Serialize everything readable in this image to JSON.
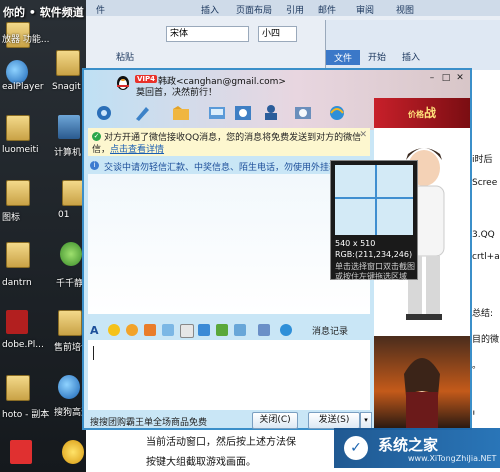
{
  "watermark_top": "你的 • 软件频道 software.it168.com",
  "word": {
    "tabs": [
      "件",
      "插入",
      "页面布局",
      "引用",
      "邮件",
      "审阅",
      "视图"
    ],
    "font": "宋体",
    "size": "小四",
    "paste": "粘贴",
    "tabs2": [
      "文件",
      "开始",
      "插入"
    ]
  },
  "desktop_icons": [
    "放器 功能...",
    "ealPlayer",
    "Snagit",
    "luomeiti",
    "计算机",
    "图标",
    "01",
    "dantrn",
    "千千静听",
    "dobe.Pl...",
    "售前培训-务器建设",
    "hoto - 副本",
    "搜狗高速浏览器"
  ],
  "doc_right": [
    "i时后",
    "Scree",
    "3.QQ",
    "crtl+a",
    "总结:",
    "目的微",
    "。",
    "!"
  ],
  "doc_bottom": [
    "当前活动窗口，然后按上述方法保",
    "按键大组截取游戏画面。"
  ],
  "qq": {
    "vip": "VIP4",
    "name": "韩政<canghan@gmail.com>",
    "signature": "莫回首，决然前行！",
    "toolbar_icons": [
      "video-call",
      "voice-call",
      "send-file",
      "create-discussion",
      "group-chat",
      "remote-assist",
      "apps",
      "ie"
    ],
    "notice_line1": "对方开通了微信接收QQ消息，您的消息将免费发送到对方的微信",
    "notice_line2_prefix": "信，",
    "notice_link": "点击查看详情",
    "warn": "交谈中请勿轻信汇款、中奖信息、陌生电话，勿使用外挂软件",
    "history": "消息记录",
    "ad": "搜搜团购霸王单全场商品免费",
    "close": "关闭(C)",
    "send": "发送(S)"
  },
  "ad_banner": "战",
  "ad_banner_small": "价格",
  "screenshot": {
    "size": "540 x 510",
    "rgb": "RGB:(211,234,246)",
    "hint1": "单击选择窗口双击截图",
    "hint2": "或按住左键拖选区域"
  },
  "watermark_br": {
    "name": "系统之家",
    "url": "www.XiTongZhiJia.NET"
  }
}
